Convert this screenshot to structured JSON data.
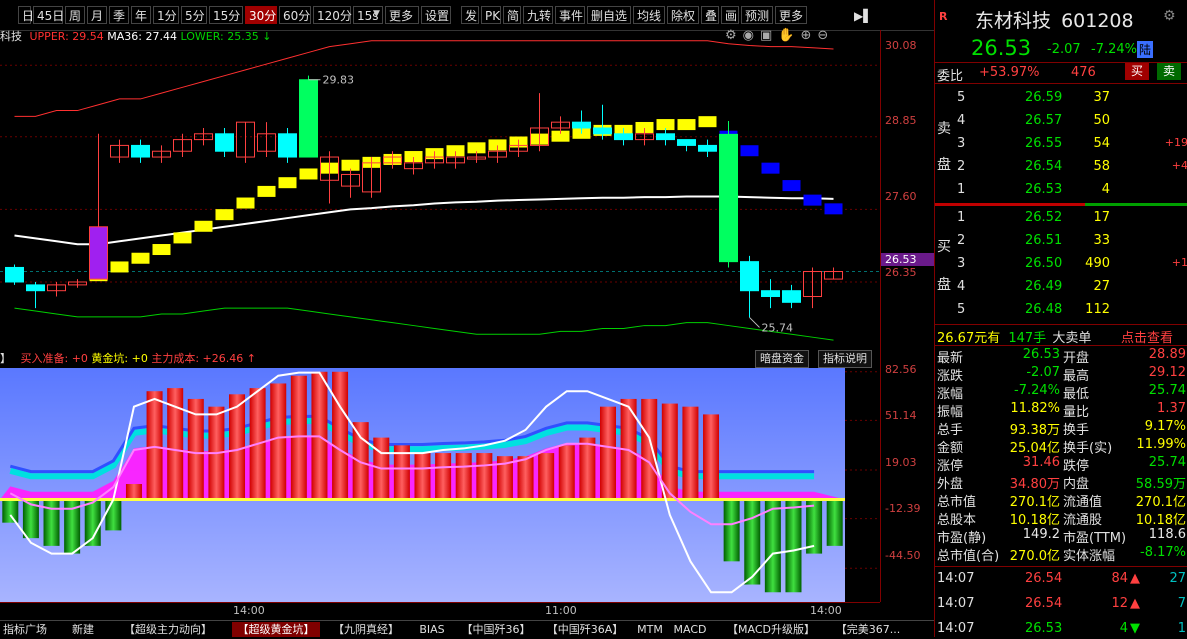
{
  "toolbar": {
    "items": [
      "日",
      "45日",
      "周",
      "月",
      "季",
      "年",
      "1分",
      "5分",
      "15分",
      "30分",
      "60分",
      "120分",
      "15s",
      "更多",
      "设置",
      "发",
      "PK",
      "简",
      "九转",
      "事件",
      "删自选",
      "均线",
      "除权",
      "叠",
      "画",
      "预测",
      "更多"
    ],
    "active": "30分",
    "dropdown_mark": "▼",
    "more_icon": "▶▌"
  },
  "main_legend": {
    "name": "科技",
    "upper_label": "UPPER: 29.54",
    "ma_label": "MA36: 27.44",
    "lower_label": "LOWER: 25.35",
    "lower_arrow": "↓",
    "upper_color": "#ff3030",
    "ma_color": "#ffffff",
    "lower_color": "#00d000"
  },
  "price_axis": {
    "ticks": [
      "30.08",
      "28.85",
      "27.60",
      "26.35"
    ],
    "current": "26.53"
  },
  "indicator_axis": {
    "ticks": [
      "82.56",
      "51.14",
      "19.03",
      "-12.39",
      "-44.50"
    ]
  },
  "indicator_legend": {
    "items": [
      "买入准备: +0",
      "黄金坑: +0",
      "主力成本: +26.46"
    ],
    "arrow": "↑",
    "buttons": [
      "暗盘资金",
      "指标说明"
    ],
    "prefix": "】"
  },
  "time_axis": [
    "14:00",
    "11:00",
    "14:00"
  ],
  "annotations": {
    "high": "29.83",
    "low": "25.74"
  },
  "bottom_tabs": [
    "指标广场",
    "新建",
    "【超级主力动向】",
    "【超级黄金坑】",
    "【九阴真经】",
    "BIAS",
    "【中国歼36】",
    "【中国歼36A】",
    "MTM",
    "MACD",
    "【MACD升级版】",
    "【完美367..."
  ],
  "bottom_active": "【超级黄金坑】",
  "quote": {
    "badge": "R",
    "name": "东材科技",
    "code": "601208",
    "price": "26.53",
    "change": "-2.07",
    "pct": "-7.24%",
    "market": "陆",
    "weibi_label": "委比",
    "weibi": "+53.97%",
    "weicha": "476",
    "buy_btn": "买",
    "sell_btn": "卖",
    "sell_side_label": [
      "卖",
      "盘"
    ],
    "buy_side_label": [
      "买",
      "盘"
    ],
    "asks": [
      {
        "lvl": "5",
        "price": "26.59",
        "vol": "37",
        "chg": ""
      },
      {
        "lvl": "4",
        "price": "26.57",
        "vol": "50",
        "chg": ""
      },
      {
        "lvl": "3",
        "price": "26.55",
        "vol": "54",
        "chg": "+19"
      },
      {
        "lvl": "2",
        "price": "26.54",
        "vol": "58",
        "chg": "+4"
      },
      {
        "lvl": "1",
        "price": "26.53",
        "vol": "4",
        "chg": ""
      }
    ],
    "bids": [
      {
        "lvl": "1",
        "price": "26.52",
        "vol": "17",
        "chg": ""
      },
      {
        "lvl": "2",
        "price": "26.51",
        "vol": "33",
        "chg": ""
      },
      {
        "lvl": "3",
        "price": "26.50",
        "vol": "490",
        "chg": "+1"
      },
      {
        "lvl": "4",
        "price": "26.49",
        "vol": "27",
        "chg": ""
      },
      {
        "lvl": "5",
        "price": "26.48",
        "vol": "112",
        "chg": ""
      }
    ],
    "big_order": {
      "price": "26.67元有",
      "vol": "147手",
      "label": "大卖单",
      "link": "点击查看"
    },
    "stats": [
      {
        "l": "最新",
        "v": "26.53",
        "vc": "green",
        "l2": "开盘",
        "v2": "28.89",
        "v2c": "red"
      },
      {
        "l": "涨跌",
        "v": "-2.07",
        "vc": "green",
        "l2": "最高",
        "v2": "29.12",
        "v2c": "red"
      },
      {
        "l": "涨幅",
        "v": "-7.24%",
        "vc": "green",
        "l2": "最低",
        "v2": "25.74",
        "v2c": "green"
      },
      {
        "l": "振幅",
        "v": "11.82%",
        "vc": "yellow",
        "l2": "量比",
        "v2": "1.37",
        "v2c": "red"
      },
      {
        "l": "总手",
        "v": "93.38万",
        "vc": "yellow",
        "l2": "换手",
        "v2": "9.17%",
        "v2c": "yellow"
      },
      {
        "l": "金额",
        "v": "25.04亿",
        "vc": "yellow",
        "l2": "换手(实)",
        "v2": "11.99%",
        "v2c": "yellow"
      },
      {
        "l": "涨停",
        "v": "31.46",
        "vc": "red",
        "l2": "跌停",
        "v2": "25.74",
        "v2c": "green"
      },
      {
        "l": "外盘",
        "v": "34.80万",
        "vc": "red",
        "l2": "内盘",
        "v2": "58.59万",
        "v2c": "green"
      },
      {
        "l": "总市值",
        "v": "270.1亿",
        "vc": "yellow",
        "l2": "流通值",
        "v2": "270.1亿",
        "v2c": "yellow"
      },
      {
        "l": "总股本",
        "v": "10.18亿",
        "vc": "yellow",
        "l2": "流通股",
        "v2": "10.18亿",
        "v2c": "yellow"
      },
      {
        "l": "市盈(静)",
        "v": "149.2",
        "vc": "white",
        "l2": "市盈(TTM)",
        "v2": "118.6",
        "v2c": "white"
      },
      {
        "l": "总市值(合)",
        "v": "270.0亿",
        "vc": "yellow",
        "l2": "实体涨幅",
        "v2": "-8.17%",
        "v2c": "green"
      }
    ],
    "ticks": [
      {
        "t": "14:07",
        "p": "26.54",
        "v": "84",
        "dir": "up",
        "n": "27"
      },
      {
        "t": "14:07",
        "p": "26.54",
        "v": "12",
        "dir": "up",
        "n": "7"
      },
      {
        "t": "14:07",
        "p": "26.53",
        "v": "4",
        "dir": "down",
        "n": "1"
      }
    ]
  },
  "chart_data": {
    "type": "candlestick",
    "title": "",
    "price_ylim": [
      25.3,
      30.6
    ],
    "candles_ohlc": [
      [
        26.6,
        26.35,
        26.65,
        26.3
      ],
      [
        26.3,
        26.2,
        26.35,
        25.9
      ],
      [
        26.2,
        26.3,
        26.35,
        26.1
      ],
      [
        26.3,
        26.35,
        26.4,
        26.25
      ],
      [
        26.4,
        27.3,
        28.9,
        26.4
      ],
      [
        28.5,
        28.7,
        28.8,
        28.4
      ],
      [
        28.7,
        28.5,
        28.8,
        28.4
      ],
      [
        28.5,
        28.6,
        28.7,
        28.4
      ],
      [
        28.6,
        28.8,
        28.9,
        28.5
      ],
      [
        28.8,
        28.9,
        29.0,
        28.7
      ],
      [
        28.9,
        28.6,
        29.0,
        28.5
      ],
      [
        28.5,
        29.1,
        29.1,
        28.4
      ],
      [
        28.6,
        28.9,
        29.1,
        28.5
      ],
      [
        28.9,
        28.5,
        29.0,
        28.4
      ],
      [
        28.5,
        29.83,
        29.9,
        28.5
      ],
      [
        28.1,
        28.5,
        28.6,
        27.7
      ],
      [
        28.0,
        28.2,
        28.3,
        27.8
      ],
      [
        27.9,
        28.4,
        28.5,
        27.8
      ],
      [
        28.4,
        28.5,
        28.6,
        28.3
      ],
      [
        28.3,
        28.4,
        28.5,
        28.2
      ],
      [
        28.4,
        28.5,
        28.6,
        28.3
      ],
      [
        28.4,
        28.5,
        28.6,
        28.3
      ],
      [
        28.5,
        28.5,
        28.6,
        28.4
      ],
      [
        28.5,
        28.6,
        28.7,
        28.4
      ],
      [
        28.6,
        28.7,
        28.8,
        28.5
      ],
      [
        28.7,
        29.0,
        29.6,
        28.6
      ],
      [
        29.0,
        29.1,
        29.2,
        28.9
      ],
      [
        29.1,
        29.0,
        29.3,
        28.9
      ],
      [
        29.0,
        28.9,
        29.4,
        28.8
      ],
      [
        28.9,
        28.8,
        29.0,
        28.7
      ],
      [
        28.8,
        28.9,
        29.0,
        28.7
      ],
      [
        28.9,
        28.8,
        29.0,
        28.7
      ],
      [
        28.8,
        28.7,
        28.8,
        28.6
      ],
      [
        28.7,
        28.6,
        28.8,
        28.5
      ],
      [
        28.89,
        26.7,
        29.12,
        26.6
      ],
      [
        26.7,
        26.2,
        26.8,
        25.74
      ],
      [
        26.2,
        26.1,
        26.4,
        25.9
      ],
      [
        26.2,
        26.0,
        26.3,
        25.9
      ],
      [
        26.1,
        26.53,
        26.6,
        25.9
      ],
      [
        26.4,
        26.53,
        26.6,
        26.4
      ]
    ],
    "upper_band": [
      29.2,
      29.2,
      29.3,
      29.3,
      29.4,
      29.5,
      29.5,
      29.6,
      29.7,
      29.8,
      29.9,
      30.0,
      30.1,
      30.2,
      30.3,
      30.4,
      30.45,
      30.5,
      30.5,
      30.5,
      30.5,
      30.5,
      30.5,
      30.5,
      30.5,
      30.5,
      30.5,
      30.5,
      30.5,
      30.5,
      30.5,
      30.5,
      30.5,
      30.5,
      30.45,
      30.42,
      30.4,
      30.4,
      30.38,
      30.36
    ],
    "ma36": [
      27.15,
      27.1,
      27.05,
      27.0,
      27.0,
      27.05,
      27.1,
      27.15,
      27.2,
      27.25,
      27.3,
      27.35,
      27.4,
      27.45,
      27.5,
      27.55,
      27.6,
      27.62,
      27.65,
      27.67,
      27.7,
      27.72,
      27.73,
      27.75,
      27.76,
      27.77,
      27.78,
      27.79,
      27.8,
      27.8,
      27.81,
      27.81,
      27.82,
      27.82,
      27.82,
      27.81,
      27.8,
      27.79,
      27.79,
      27.78
    ],
    "lower_band": [
      25.9,
      25.85,
      25.8,
      25.75,
      25.75,
      25.75,
      25.75,
      25.8,
      25.8,
      25.85,
      25.9,
      25.9,
      25.9,
      25.9,
      25.85,
      25.8,
      25.75,
      25.7,
      25.65,
      25.6,
      25.55,
      25.5,
      25.45,
      25.45,
      25.45,
      25.45,
      25.5,
      25.5,
      25.55,
      25.55,
      25.6,
      25.6,
      25.65,
      25.65,
      25.6,
      25.55,
      25.5,
      25.45,
      25.4,
      25.35
    ],
    "step_markers": [
      null,
      null,
      null,
      null,
      26.45,
      26.6,
      26.75,
      26.9,
      27.1,
      27.3,
      27.5,
      27.7,
      27.9,
      28.05,
      28.2,
      28.3,
      28.35,
      28.4,
      28.45,
      28.5,
      28.55,
      28.6,
      28.65,
      28.7,
      28.75,
      28.8,
      28.85,
      28.9,
      28.95,
      28.95,
      29.0,
      29.05,
      29.05,
      29.1,
      28.85,
      28.6,
      28.3,
      28.0,
      27.75,
      27.6
    ],
    "indicator_ylim": [
      -65,
      85
    ],
    "indicator_bars": [
      -15,
      -25,
      -30,
      -35,
      -30,
      -20,
      10,
      70,
      72,
      65,
      60,
      68,
      72,
      75,
      80,
      82.56,
      82.56,
      50,
      40,
      35,
      30,
      30,
      30,
      30,
      28,
      28,
      30,
      35,
      40,
      60,
      65,
      65,
      62,
      60,
      55,
      -40,
      -55,
      -60,
      -60,
      -35,
      -30
    ],
    "indicator_line": [
      -10,
      -28,
      -35,
      -35,
      -25,
      0,
      60,
      65,
      60,
      55,
      55,
      60,
      70,
      80,
      82,
      82,
      60,
      40,
      30,
      30,
      30,
      32,
      33,
      35,
      38,
      45,
      60,
      70,
      70,
      65,
      60,
      40,
      -10,
      -40,
      -60,
      -60,
      -50,
      -35,
      -33,
      -30
    ]
  }
}
